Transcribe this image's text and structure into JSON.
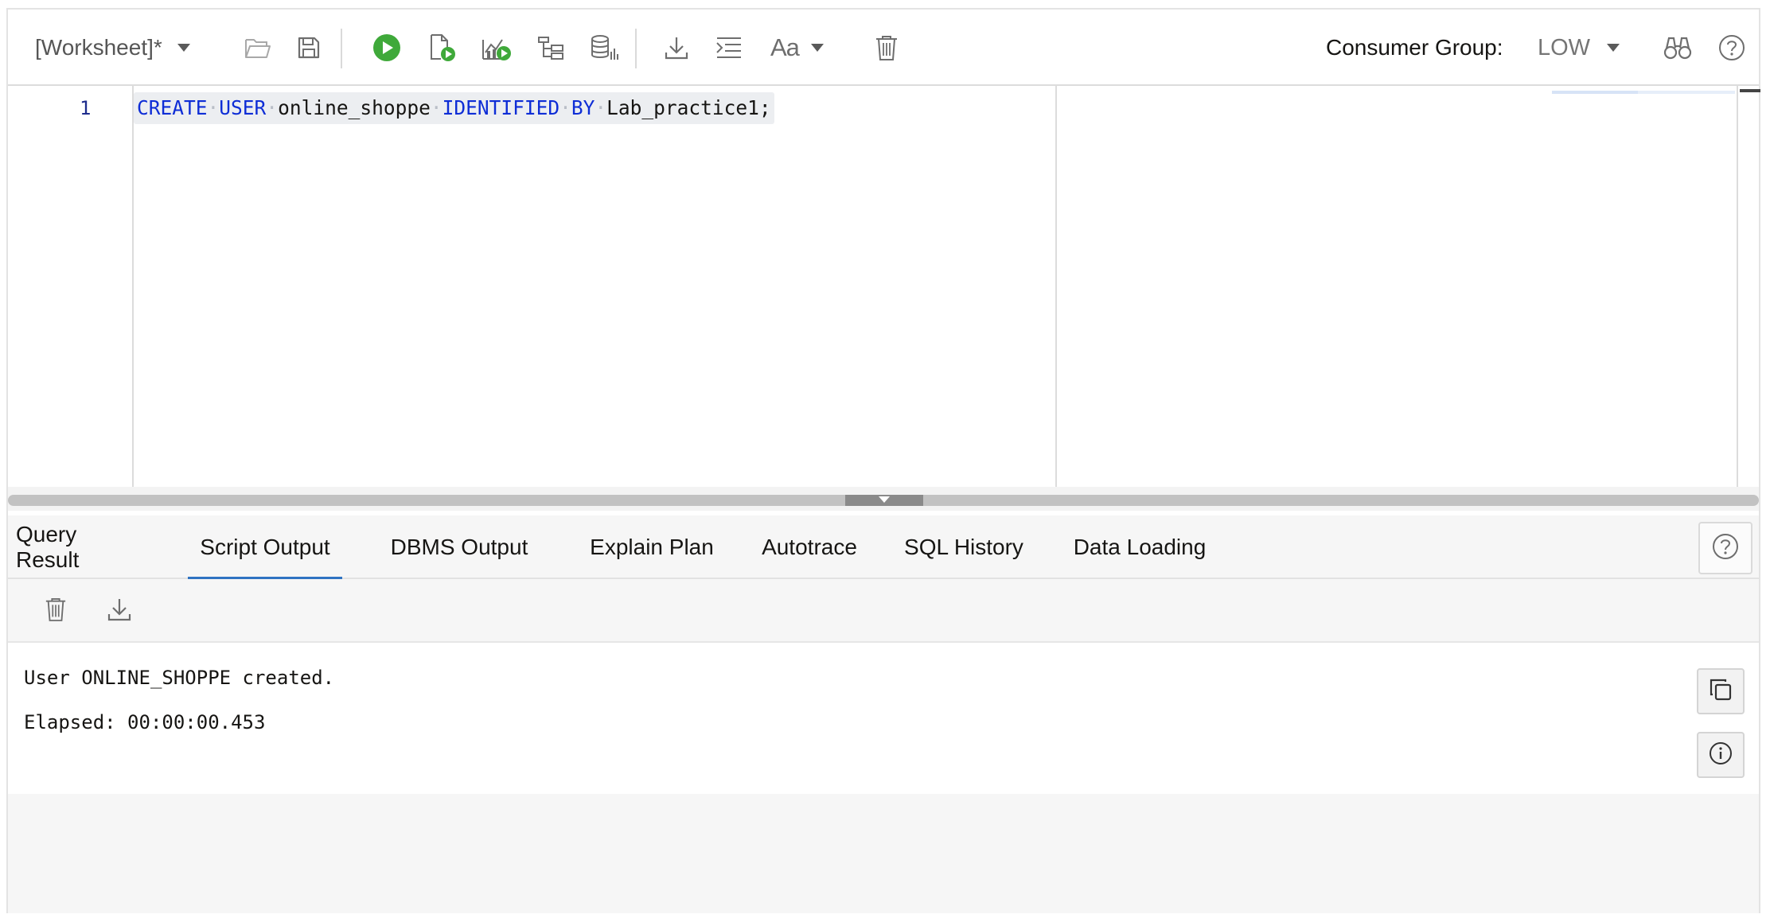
{
  "toolbar": {
    "worksheet_label": "[Worksheet]*",
    "consumer_group_label": "Consumer Group:",
    "consumer_group_value": "LOW",
    "font_label": "Aa",
    "icons": [
      "folder-open-icon",
      "save-icon",
      "run-statement-icon",
      "run-script-icon",
      "autotrace-icon",
      "explain-plan-icon",
      "sql-tuning-icon",
      "download-icon",
      "format-code-icon",
      "font-size-icon",
      "clear-icon",
      "find-icon",
      "help-icon"
    ],
    "run_color": "#3fa93a"
  },
  "editor": {
    "line_number": "1",
    "code": {
      "kw1": "CREATE",
      "kw2": "USER",
      "ident1": "online_shoppe",
      "kw3": "IDENTIFIED",
      "kw4": "BY",
      "ident2": "Lab_practice1;"
    },
    "keyword_color": "#0e2dd6"
  },
  "tabs": [
    {
      "label": "Query Result"
    },
    {
      "label": "Script Output"
    },
    {
      "label": "DBMS Output"
    },
    {
      "label": "Explain Plan"
    },
    {
      "label": "Autotrace"
    },
    {
      "label": "SQL History"
    },
    {
      "label": "Data Loading"
    }
  ],
  "active_tab": "Script Output",
  "active_tab_color": "#2f73c2",
  "output": {
    "line1": "User ONLINE_SHOPPE created.",
    "line2": "Elapsed: 00:00:00.453"
  }
}
